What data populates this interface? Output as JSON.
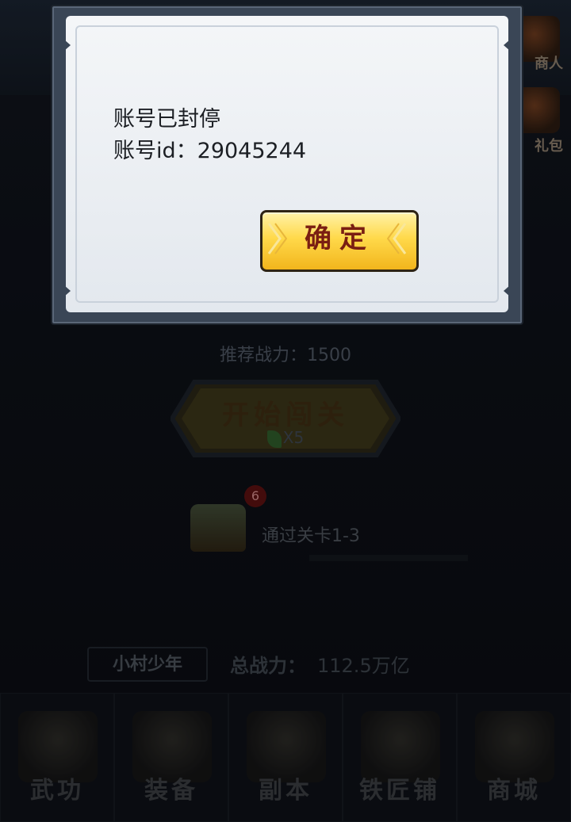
{
  "dialog": {
    "message_line1": "账号已封停",
    "message_line2": "账号id：29045244",
    "confirm_label": "确定"
  },
  "background": {
    "side_buttons": [
      "商人",
      "礼包"
    ],
    "recommended_power": "推荐战力：1500",
    "start_button_label": "开始闯关",
    "start_cost": "X5",
    "chest_badge": "6",
    "quest_text": "通过关卡1-3",
    "player_title": "小村少年",
    "total_power_label": "总战力：",
    "total_power_value": "112.5万亿",
    "nav": [
      {
        "label": "武功",
        "icon": "scroll-icon"
      },
      {
        "label": "装备",
        "icon": "armor-icon"
      },
      {
        "label": "副本",
        "icon": "crossed-swords-icon"
      },
      {
        "label": "铁匠铺",
        "icon": "hammer-icon"
      },
      {
        "label": "商城",
        "icon": "shop-icon"
      }
    ]
  },
  "colors": {
    "button_gold": "#ffd94a",
    "button_text": "#7a1e12",
    "dialog_paper": "#eef1f4",
    "dialog_frame": "#3a4656"
  }
}
